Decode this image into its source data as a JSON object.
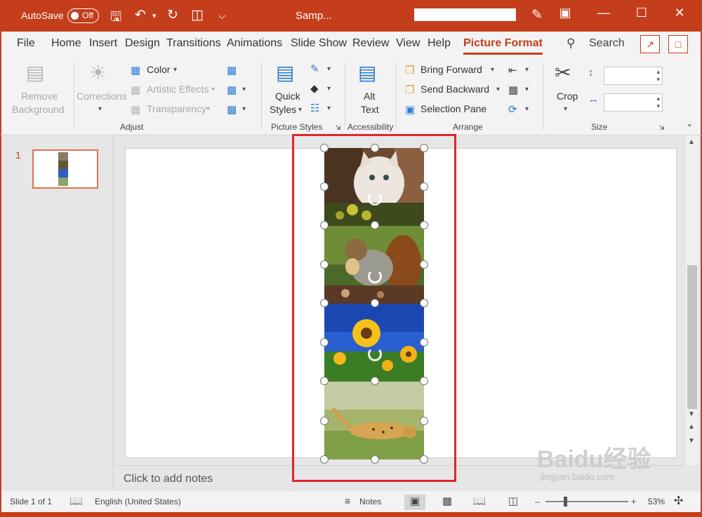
{
  "titlebar": {
    "autosave_label": "AutoSave",
    "autosave_state": "Off",
    "doc_title": "Samp...",
    "icons": [
      "save-icon",
      "undo-icon",
      "redo-icon",
      "present-icon",
      "customize-icon",
      "designer-icon",
      "ribbon-display-icon",
      "minimize-icon",
      "maximize-icon",
      "close-icon"
    ]
  },
  "tabs": {
    "items": [
      "File",
      "Home",
      "Insert",
      "Design",
      "Transitions",
      "Animations",
      "Slide Show",
      "Review",
      "View",
      "Help",
      "Picture Format"
    ],
    "active": "Picture Format",
    "search_label": "Search"
  },
  "ribbon": {
    "remove_background": [
      "Remove",
      "Background"
    ],
    "corrections": "Corrections",
    "color": "Color",
    "artistic_effects": "Artistic Effects",
    "transparency": "Transparency",
    "quick_styles": [
      "Quick",
      "Styles"
    ],
    "alt_text": [
      "Alt",
      "Text"
    ],
    "bring_forward": "Bring Forward",
    "send_backward": "Send Backward",
    "selection_pane": "Selection Pane",
    "crop": "Crop",
    "groups": {
      "adjust": "Adjust",
      "picture_styles": "Picture Styles",
      "accessibility": "Accessibility",
      "arrange": "Arrange",
      "size": "Size"
    }
  },
  "thumbnails": {
    "slide_number": "1"
  },
  "notes_placeholder": "Click to add notes",
  "pictures": [
    "cat",
    "squirrel",
    "sunflower",
    "cheetah"
  ],
  "statusbar": {
    "slide_info": "Slide 1 of 1",
    "language": "English (United States)",
    "notes_label": "Notes",
    "zoom_percent": "53%",
    "minus": "–",
    "plus": "+"
  },
  "watermark": {
    "main": "Baidu经验",
    "sub": "jingyan.baidu.com"
  },
  "colors": {
    "accent": "#c43e1c",
    "selection_outline": "#e0262b"
  }
}
